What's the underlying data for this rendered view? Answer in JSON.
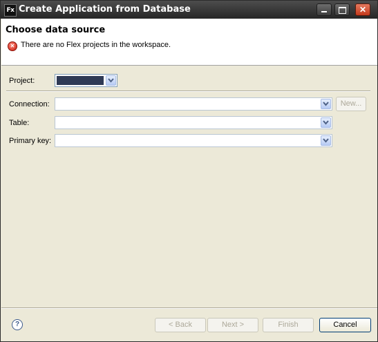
{
  "window": {
    "app_icon_text": "Fx",
    "title": "Create Application from Database"
  },
  "header": {
    "title": "Choose data source",
    "error_message": "There are no Flex projects in the workspace."
  },
  "form": {
    "project_label": "Project:",
    "connection_label": "Connection:",
    "table_label": "Table:",
    "primary_key_label": "Primary key:",
    "connection_value": "",
    "table_value": "",
    "primary_key_value": "",
    "new_button": "New..."
  },
  "footer": {
    "back_button": "< Back",
    "next_button": "Next >",
    "finish_button": "Finish",
    "cancel_button": "Cancel"
  },
  "colors": {
    "title_bar": "#262626",
    "dialog_bg": "#ece9d8",
    "error_red": "#c8190c"
  }
}
